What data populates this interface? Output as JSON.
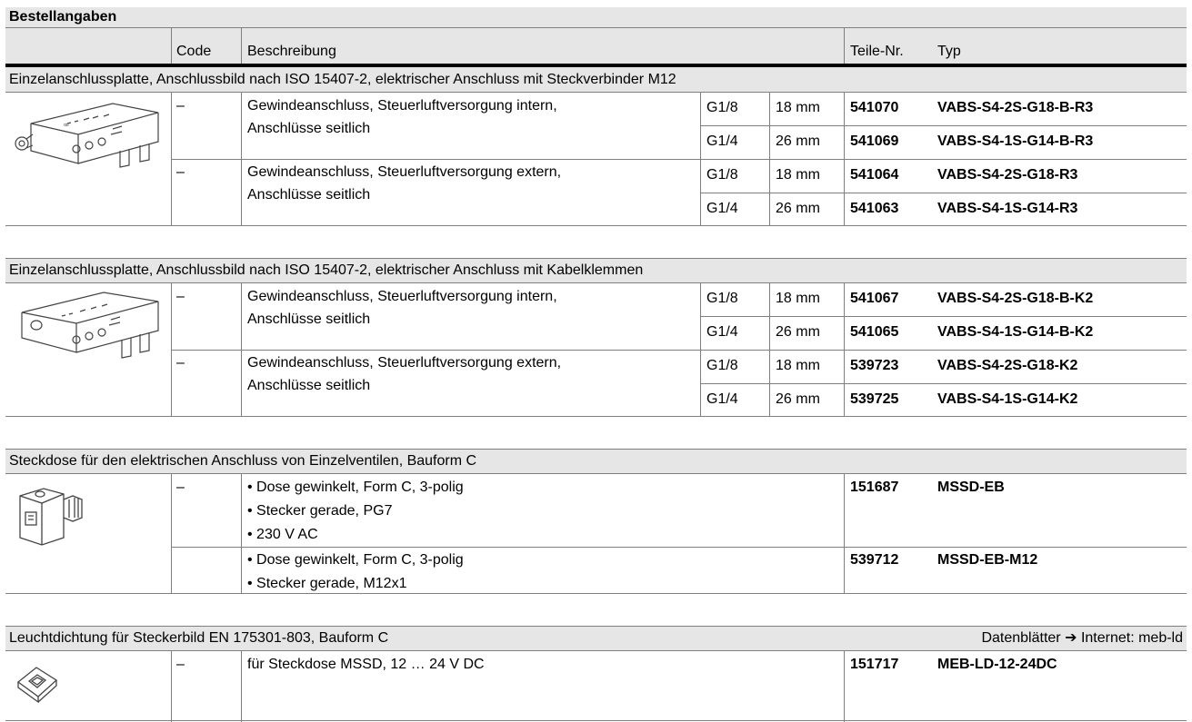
{
  "title": "Bestellangaben",
  "headers": {
    "code": "Code",
    "beschreibung": "Beschreibung",
    "teilenr": "Teile-Nr.",
    "typ": "Typ"
  },
  "sections": [
    {
      "heading": "Einzelanschlussplatte, Anschlussbild nach ISO 15407-2, elektrischer Anschluss mit Steckverbinder M12",
      "icon": "subbase-m12-icon",
      "groups": [
        {
          "code": "–",
          "desc": "Gewindeanschluss, Steuerluftversorgung intern,",
          "desc2": "Anschlüsse seitlich",
          "rows": [
            {
              "thread": "G1/8",
              "width": "18 mm",
              "partno": "541070",
              "type": "VABS-S4-2S-G18-B-R3"
            },
            {
              "thread": "G1/4",
              "width": "26 mm",
              "partno": "541069",
              "type": "VABS-S4-1S-G14-B-R3"
            }
          ]
        },
        {
          "code": "–",
          "desc": "Gewindeanschluss, Steuerluftversorgung extern,",
          "desc2": "Anschlüsse seitlich",
          "rows": [
            {
              "thread": "G1/8",
              "width": "18 mm",
              "partno": "541064",
              "type": "VABS-S4-2S-G18-R3"
            },
            {
              "thread": "G1/4",
              "width": "26 mm",
              "partno": "541063",
              "type": "VABS-S4-1S-G14-R3"
            }
          ]
        }
      ]
    },
    {
      "heading": "Einzelanschlussplatte, Anschlussbild nach ISO 15407-2, elektrischer Anschluss mit Kabelklemmen",
      "icon": "subbase-terminal-icon",
      "groups": [
        {
          "code": "–",
          "desc": "Gewindeanschluss, Steuerluftversorgung intern,",
          "desc2": "Anschlüsse seitlich",
          "rows": [
            {
              "thread": "G1/8",
              "width": "18 mm",
              "partno": "541067",
              "type": "VABS-S4-2S-G18-B-K2"
            },
            {
              "thread": "G1/4",
              "width": "26 mm",
              "partno": "541065",
              "type": "VABS-S4-1S-G14-B-K2"
            }
          ]
        },
        {
          "code": "–",
          "desc": "Gewindeanschluss, Steuerluftversorgung extern,",
          "desc2": "Anschlüsse seitlich",
          "rows": [
            {
              "thread": "G1/8",
              "width": "18 mm",
              "partno": "539723",
              "type": "VABS-S4-2S-G18-K2"
            },
            {
              "thread": "G1/4",
              "width": "26 mm",
              "partno": "539725",
              "type": "VABS-S4-1S-G14-K2"
            }
          ]
        }
      ]
    },
    {
      "heading": "Steckdose für den elektrischen Anschluss von Einzelventilen, Bauform C",
      "icon": "plug-socket-icon",
      "items": [
        {
          "code": "–",
          "bullets": [
            "Dose gewinkelt, Form C, 3-polig",
            "Stecker gerade, PG7",
            "230 V AC"
          ],
          "partno": "151687",
          "type": "MSSD-EB"
        },
        {
          "bullets": [
            "Dose gewinkelt, Form C, 3-polig",
            "Stecker gerade, M12x1"
          ],
          "partno": "539712",
          "type": "MSSD-EB-M12"
        }
      ]
    },
    {
      "heading": "Leuchtdichtung für Steckerbild EN 175301-803, Bauform C",
      "note_prefix": "Datenblätter",
      "note_arrow": "➔",
      "note_suffix": "Internet: meb-ld",
      "icon": "seal-icon",
      "items": [
        {
          "code": "–",
          "desc": "für Steckdose MSSD, 12 … 24 V DC",
          "partno": "151717",
          "type": "MEB-LD-12-24DC"
        }
      ]
    }
  ]
}
